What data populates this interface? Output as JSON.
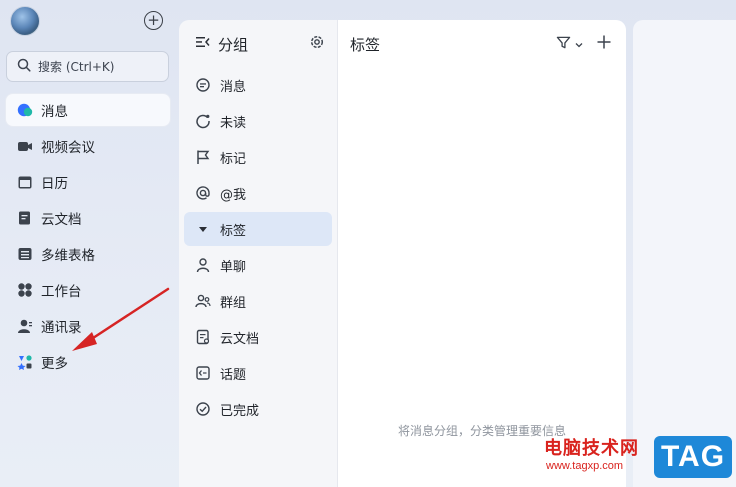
{
  "sidebar": {
    "search_placeholder": "搜索 (Ctrl+K)",
    "items": [
      {
        "label": "消息",
        "icon": "chat-bubble-icon",
        "active": true
      },
      {
        "label": "视频会议",
        "icon": "video-camera-icon"
      },
      {
        "label": "日历",
        "icon": "calendar-icon"
      },
      {
        "label": "云文档",
        "icon": "cloud-doc-icon"
      },
      {
        "label": "多维表格",
        "icon": "table-icon"
      },
      {
        "label": "工作台",
        "icon": "grid-apps-icon"
      },
      {
        "label": "通讯录",
        "icon": "contacts-icon"
      },
      {
        "label": "更多",
        "icon": "more-apps-icon"
      }
    ]
  },
  "groups": {
    "title": "分组",
    "items": [
      {
        "label": "消息",
        "icon": "message-icon"
      },
      {
        "label": "未读",
        "icon": "unread-icon"
      },
      {
        "label": "标记",
        "icon": "flag-icon"
      },
      {
        "label": "@我",
        "icon": "at-icon"
      },
      {
        "label": "标签",
        "icon": "triangle-down-icon",
        "active": true
      },
      {
        "label": "单聊",
        "icon": "person-icon"
      },
      {
        "label": "群组",
        "icon": "group-icon"
      },
      {
        "label": "云文档",
        "icon": "document-icon"
      },
      {
        "label": "话题",
        "icon": "topic-icon"
      },
      {
        "label": "已完成",
        "icon": "check-circle-icon"
      }
    ]
  },
  "content": {
    "title": "标签",
    "empty_hint": "将消息分组，分类管理重要信息"
  },
  "watermark": {
    "title": "电脑技术网",
    "url": "www.tagxp.com",
    "tag": "TAG"
  },
  "colors": {
    "accent": "#3370ff",
    "active_group_bg": "#dde7f7",
    "annotation_arrow": "#d62424",
    "watermark_red": "#d9231e",
    "watermark_blue": "#1e88d8"
  }
}
